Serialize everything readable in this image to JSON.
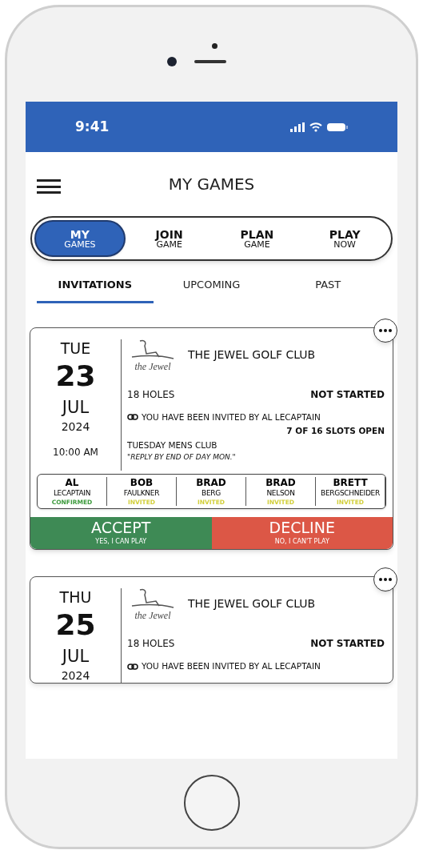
{
  "status_bar": {
    "time": "9:41"
  },
  "header": {
    "title": "MY GAMES"
  },
  "segments": [
    {
      "top": "MY",
      "bottom": "GAMES",
      "selected": true
    },
    {
      "top": "JOIN",
      "bottom": "GAME",
      "selected": false
    },
    {
      "top": "PLAN",
      "bottom": "GAME",
      "selected": false
    },
    {
      "top": "PLAY",
      "bottom": "NOW",
      "selected": false
    }
  ],
  "tabs": [
    {
      "label": "INVITATIONS",
      "selected": true
    },
    {
      "label": "UPCOMING",
      "selected": false
    },
    {
      "label": "PAST",
      "selected": false
    }
  ],
  "games": [
    {
      "weekday": "TUE",
      "day": "23",
      "month": "JUL",
      "year": "2024",
      "time": "10:00 AM",
      "logo": "the Jewel",
      "club": "THE JEWEL GOLF CLUB",
      "holes": "18 HOLES",
      "status": "NOT STARTED",
      "invite": "YOU HAVE BEEN INVITED BY AL LECAPTAIN",
      "slots": "7 OF 16 SLOTS OPEN",
      "group": "TUESDAY MENS CLUB",
      "note": "\"REPLY BY END OF DAY MON.\"",
      "players": [
        {
          "first": "AL",
          "last": "LECAPTAIN",
          "status": "CONFIRMED",
          "kind": "confirmed"
        },
        {
          "first": "BOB",
          "last": "FAULKNER",
          "status": "INVITED",
          "kind": "invited"
        },
        {
          "first": "BRAD",
          "last": "BERG",
          "status": "INVITED",
          "kind": "invited"
        },
        {
          "first": "BRAD",
          "last": "NELSON",
          "status": "INVITED",
          "kind": "invited"
        },
        {
          "first": "BRETT",
          "last": "BERGSCHNEIDER",
          "status": "INVITED",
          "kind": "invited"
        }
      ],
      "accept": {
        "label": "ACCEPT",
        "sub": "YES, I CAN PLAY"
      },
      "decline": {
        "label": "DECLINE",
        "sub": "NO, I CAN'T PLAY"
      }
    },
    {
      "weekday": "THU",
      "day": "25",
      "month": "JUL",
      "year": "2024",
      "logo": "the Jewel",
      "club": "THE JEWEL GOLF CLUB",
      "holes": "18 HOLES",
      "status": "NOT STARTED",
      "invite": "YOU HAVE BEEN INVITED BY AL LECAPTAIN"
    }
  ]
}
